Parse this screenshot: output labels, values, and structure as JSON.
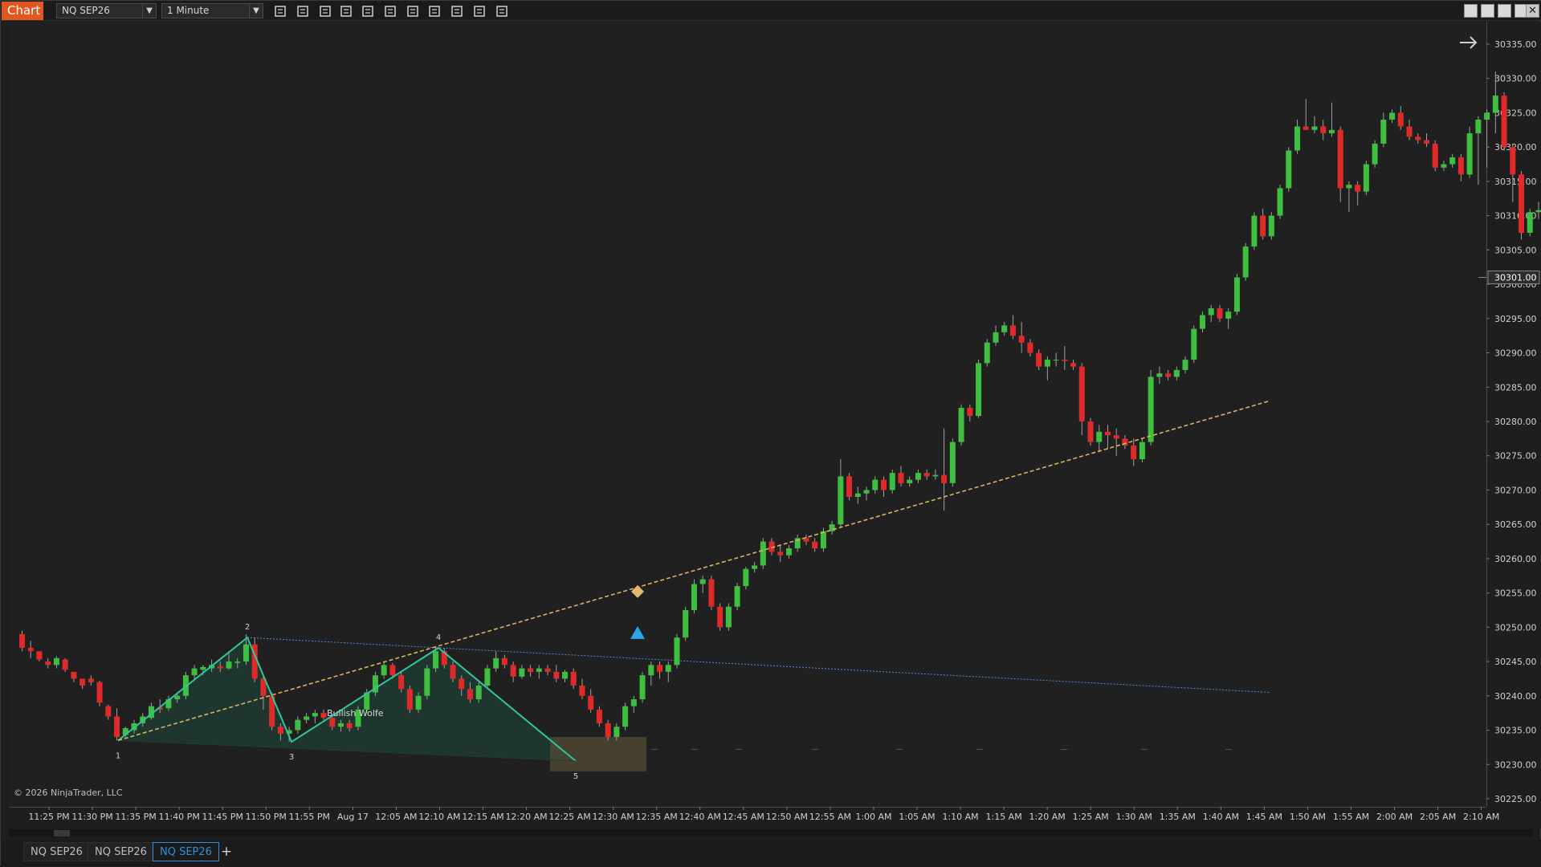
{
  "toolbar": {
    "chart_label": "Chart",
    "instrument": "NQ SEP26",
    "interval": "1 Minute",
    "tools": [
      "bar-type-icon",
      "pencil-icon",
      "zoom-in-icon",
      "zoom-out-icon",
      "pointer-icon",
      "properties-icon",
      "data-box-icon",
      "strategies-icon",
      "indicators-icon",
      "chart-trader-icon",
      "list-icon"
    ],
    "window_buttons": [
      "tile-icon",
      "maximize-icon",
      "minimize-icon",
      "restore-icon",
      "close-icon"
    ]
  },
  "tabs": [
    {
      "label": "NQ SEP26",
      "active": false
    },
    {
      "label": "NQ SEP26",
      "active": false
    },
    {
      "label": "NQ SEP26",
      "active": true
    }
  ],
  "add_tab_label": "+",
  "copyright": "© 2026 NinjaTrader, LLC",
  "colors": {
    "up": "#3fbf3f",
    "down": "#e02a2a",
    "wolfe_line": "#2fc7a0",
    "wolfe_fill": "#1f3b31",
    "target_line": "#d9b45a",
    "blue_line": "#4a8fd0",
    "target_box": "#4e4632",
    "price_marker": "#2c2c2c"
  },
  "chart_data": {
    "type": "candlestick",
    "price_axis": {
      "ticks": [
        "30335.00",
        "30330.00",
        "30325.00",
        "30320.00",
        "30315.00",
        "30310.00",
        "30305.00",
        "30300.00",
        "30295.00",
        "30290.00",
        "30285.00",
        "30280.00",
        "30275.00",
        "30270.00",
        "30265.00",
        "30260.00",
        "30255.00",
        "30250.00",
        "30245.00",
        "30240.00",
        "30235.00",
        "30230.00",
        "30225.00"
      ],
      "range": [
        30224,
        30336
      ],
      "current_price": "30301.00"
    },
    "time_axis": {
      "labels": [
        "11:25 PM",
        "11:30 PM",
        "11:35 PM",
        "11:40 PM",
        "11:45 PM",
        "11:50 PM",
        "11:55 PM",
        "Aug 17",
        "12:05 AM",
        "12:10 AM",
        "12:15 AM",
        "12:20 AM",
        "12:25 AM",
        "12:30 AM",
        "12:35 AM",
        "12:40 AM",
        "12:45 AM",
        "12:50 AM",
        "12:55 AM",
        "1:00 AM",
        "1:05 AM",
        "1:10 AM",
        "1:15 AM",
        "1:20 AM",
        "1:25 AM",
        "1:30 AM",
        "1:35 AM",
        "1:40 AM",
        "1:45 AM",
        "1:50 AM",
        "1:55 AM",
        "2:00 AM",
        "2:05 AM",
        "2:10 AM"
      ]
    },
    "candles": [
      [
        30249,
        30249.5,
        30246.5,
        30247
      ],
      [
        30247,
        30248,
        30245.5,
        30246.5
      ],
      [
        30246.5,
        30246.5,
        30245,
        30245.3
      ],
      [
        30245,
        30245.5,
        30244,
        30244.5
      ],
      [
        30244.5,
        30245.8,
        30244,
        30245.5
      ],
      [
        30245.3,
        30245.5,
        30243.5,
        30243.8
      ],
      [
        30243.5,
        30243.5,
        30242,
        30242.5
      ],
      [
        30242.5,
        30242.5,
        30241,
        30241.5
      ],
      [
        30242.5,
        30243,
        30241.5,
        30242
      ],
      [
        30242,
        30242.2,
        30238.5,
        30239
      ],
      [
        30238.5,
        30238.7,
        30236.5,
        30237
      ],
      [
        30237,
        30238.2,
        30233.5,
        30234
      ],
      [
        30234.3,
        30235.5,
        30234,
        30235.3
      ],
      [
        30235,
        30236.5,
        30234.5,
        30236
      ],
      [
        30236,
        30237.5,
        30235.5,
        30237
      ],
      [
        30236.8,
        30239,
        30236.5,
        30238.5
      ],
      [
        30238.3,
        30239.5,
        30237.5,
        30238
      ],
      [
        30238.2,
        30240,
        30237.8,
        30239.5
      ],
      [
        30239.5,
        30240.5,
        30239,
        30240
      ],
      [
        30240,
        30243.5,
        30239.5,
        30243
      ],
      [
        30243,
        30244.5,
        30242.5,
        30244
      ],
      [
        30243.8,
        30244.5,
        30243,
        30244.2
      ],
      [
        30244,
        30245.3,
        30243.5,
        30244.5
      ],
      [
        30244.3,
        30245,
        30243.5,
        30244
      ],
      [
        30244,
        30246.5,
        30243.8,
        30245
      ],
      [
        30244.8,
        30245.5,
        30244,
        30245
      ],
      [
        30245,
        30249,
        30244.5,
        30247.5
      ],
      [
        30247.5,
        30248.5,
        30242,
        30242.5
      ],
      [
        30242.5,
        30243,
        30238,
        30240
      ],
      [
        30240,
        30240.5,
        30235,
        30235.5
      ],
      [
        30235.5,
        30236,
        30233.5,
        30234.5
      ],
      [
        30234.5,
        30235.5,
        30233.3,
        30235
      ],
      [
        30235,
        30237,
        30234.5,
        30236.5
      ],
      [
        30236.5,
        30237.5,
        30236,
        30237
      ],
      [
        30237,
        30238,
        30236,
        30237.5
      ],
      [
        30237.5,
        30238,
        30236.5,
        30236.8
      ],
      [
        30236.8,
        30237.2,
        30235,
        30235.5
      ],
      [
        30235.5,
        30236.5,
        30234.8,
        30236
      ],
      [
        30236,
        30236.5,
        30234.8,
        30235.3
      ],
      [
        30235.5,
        30238.5,
        30235,
        30238
      ],
      [
        30238,
        30241,
        30237.5,
        30240.5
      ],
      [
        30240.5,
        30243.5,
        30240,
        30243
      ],
      [
        30243,
        30245,
        30242.5,
        30244.5
      ],
      [
        30244.5,
        30244.8,
        30242.5,
        30243
      ],
      [
        30243,
        30243.5,
        30240.5,
        30241
      ],
      [
        30241,
        30241.5,
        30237.5,
        30238
      ],
      [
        30238,
        30240.5,
        30237.5,
        30240
      ],
      [
        30240,
        30244.5,
        30239.5,
        30244
      ],
      [
        30244,
        30247.2,
        30243.5,
        30246.5
      ],
      [
        30246.5,
        30247,
        30244,
        30244.5
      ],
      [
        30244.5,
        30245,
        30242,
        30242.5
      ],
      [
        30242.5,
        30243,
        30240,
        30241
      ],
      [
        30241,
        30242,
        30239,
        30239.5
      ],
      [
        30239.5,
        30242,
        30239,
        30241.5
      ],
      [
        30241.5,
        30244.5,
        30241,
        30244
      ],
      [
        30244,
        30246.5,
        30243.5,
        30245.5
      ],
      [
        30245.5,
        30246,
        30244,
        30244.5
      ],
      [
        30244.5,
        30245,
        30242,
        30242.8
      ],
      [
        30242.8,
        30244.5,
        30242.5,
        30244
      ],
      [
        30244,
        30244.5,
        30242.8,
        30243.5
      ],
      [
        30243.5,
        30244.5,
        30242.5,
        30244
      ],
      [
        30244,
        30244.5,
        30243,
        30243.5
      ],
      [
        30243.5,
        30244.5,
        30242,
        30242.5
      ],
      [
        30242.5,
        30243.8,
        30242,
        30243.5
      ],
      [
        30243.5,
        30244,
        30241,
        30241.5
      ],
      [
        30241.5,
        30242.5,
        30239.5,
        30240
      ],
      [
        30240,
        30241,
        30237.5,
        30238
      ],
      [
        30238,
        30238.5,
        30235.5,
        30236
      ],
      [
        30236,
        30236.5,
        30233.5,
        30234
      ],
      [
        30234,
        30236,
        30233.5,
        30235.5
      ],
      [
        30235.5,
        30239,
        30235,
        30238.5
      ],
      [
        30238.5,
        30240,
        30237.5,
        30239.5
      ],
      [
        30239.5,
        30243.5,
        30239,
        30243
      ],
      [
        30243,
        30245,
        30241.5,
        30244.5
      ],
      [
        30244.5,
        30245,
        30242.5,
        30243.5
      ],
      [
        30243.5,
        30245,
        30242,
        30244.5
      ],
      [
        30244.5,
        30249,
        30244,
        30248.5
      ],
      [
        30248.5,
        30253,
        30248,
        30252.5
      ],
      [
        30252.5,
        30257,
        30252,
        30256.3
      ],
      [
        30256.3,
        30257.5,
        30255,
        30257
      ],
      [
        30257,
        30257.5,
        30252.5,
        30253
      ],
      [
        30253,
        30253.5,
        30249.5,
        30250
      ],
      [
        30250,
        30253.5,
        30249.5,
        30253
      ],
      [
        30253,
        30256.5,
        30252.5,
        30256
      ],
      [
        30256,
        30258.8,
        30255.5,
        30258.5
      ],
      [
        30258.5,
        30259.5,
        30258,
        30259
      ],
      [
        30259,
        30263,
        30258.5,
        30262.5
      ],
      [
        30262.5,
        30263,
        30260.5,
        30261
      ],
      [
        30261,
        30262,
        30259.5,
        30260.5
      ],
      [
        30260.5,
        30262,
        30260,
        30261.5
      ],
      [
        30261.5,
        30263.5,
        30261,
        30263
      ],
      [
        30263,
        30263.5,
        30262,
        30262.5
      ],
      [
        30262.5,
        30263,
        30261,
        30261.5
      ],
      [
        30261.5,
        30264.5,
        30261,
        30264
      ],
      [
        30264,
        30265.5,
        30263.5,
        30265
      ],
      [
        30265,
        30274.5,
        30264.5,
        30272
      ],
      [
        30272,
        30272.5,
        30268.5,
        30269
      ],
      [
        30269,
        30270.5,
        30268,
        30269.5
      ],
      [
        30269.5,
        30270.5,
        30268.5,
        30270
      ],
      [
        30270,
        30272,
        30269.5,
        30271.5
      ],
      [
        30271.5,
        30272,
        30269,
        30270
      ],
      [
        30270,
        30273,
        30269.5,
        30272.5
      ],
      [
        30272.5,
        30273.5,
        30270.5,
        30271
      ],
      [
        30271,
        30272,
        30270.5,
        30271.5
      ],
      [
        30271.5,
        30273,
        30271,
        30272.5
      ],
      [
        30272.5,
        30273,
        30271.5,
        30272
      ],
      [
        30272,
        30273,
        30271.5,
        30272.2
      ],
      [
        30272.2,
        30279,
        30267,
        30271
      ],
      [
        30271,
        30277.5,
        30270.5,
        30277
      ],
      [
        30277,
        30282.5,
        30276.5,
        30282
      ],
      [
        30282,
        30282.5,
        30280,
        30280.8
      ],
      [
        30280.8,
        30289,
        30280.5,
        30288.5
      ],
      [
        30288.5,
        30292,
        30288,
        30291.5
      ],
      [
        30291.5,
        30294,
        30291,
        30293
      ],
      [
        30293,
        30294.5,
        30292.5,
        30294
      ],
      [
        30294,
        30295.5,
        30292,
        30292.5
      ],
      [
        30292.5,
        30294.5,
        30290,
        30291.5
      ],
      [
        30291.5,
        30292,
        30289.5,
        30290
      ],
      [
        30290,
        30290.5,
        30287.5,
        30288
      ],
      [
        30288,
        30289.5,
        30286,
        30289
      ],
      [
        30289,
        30290,
        30288,
        30289
      ],
      [
        30289,
        30291,
        30287.5,
        30288.8
      ],
      [
        30288.5,
        30289,
        30287.5,
        30288
      ],
      [
        30288,
        30288.5,
        30278,
        30280
      ],
      [
        30280,
        30280.5,
        30276.5,
        30277
      ],
      [
        30277,
        30279.5,
        30275.5,
        30278.5
      ],
      [
        30278.5,
        30279.5,
        30276,
        30278
      ],
      [
        30278,
        30279,
        30275,
        30277.5
      ],
      [
        30277.5,
        30278,
        30276,
        30276.5
      ],
      [
        30276.5,
        30277.5,
        30273.5,
        30274.5
      ],
      [
        30274.5,
        30277.5,
        30274,
        30277
      ],
      [
        30277,
        30287.5,
        30276.5,
        30286.5
      ],
      [
        30286.5,
        30288,
        30285.5,
        30287
      ],
      [
        30287,
        30287.5,
        30286,
        30286.5
      ],
      [
        30286.5,
        30288,
        30286,
        30287.5
      ],
      [
        30287.5,
        30289.5,
        30287,
        30289
      ],
      [
        30289,
        30294,
        30288.5,
        30293.5
      ],
      [
        30293.5,
        30296,
        30293,
        30295.5
      ],
      [
        30295.5,
        30297,
        30294.5,
        30296.5
      ],
      [
        30296.5,
        30297,
        30294.5,
        30295
      ],
      [
        30295,
        30296.5,
        30293.5,
        30296
      ],
      [
        30296,
        30301.5,
        30295.5,
        30301
      ],
      [
        30301,
        30306,
        30300.5,
        30305.5
      ],
      [
        30305.5,
        30310.5,
        30305,
        30310
      ],
      [
        30310,
        30311,
        30306.5,
        30307
      ],
      [
        30307,
        30310.5,
        30306.5,
        30310
      ],
      [
        30310,
        30314.5,
        30309.5,
        30314
      ],
      [
        30314,
        30320,
        30313.5,
        30319.5
      ],
      [
        30319.5,
        30324,
        30319,
        30323
      ],
      [
        30323,
        30327,
        30322.5,
        30322.5
      ],
      [
        30322.5,
        30324.5,
        30322,
        30323
      ],
      [
        30323,
        30324,
        30321,
        30322
      ],
      [
        30322,
        30326.5,
        30321.5,
        30322.5
      ],
      [
        30322.5,
        30323,
        30312,
        30314
      ],
      [
        30314,
        30315,
        30310.5,
        30314.5
      ],
      [
        30314.5,
        30315,
        30311.5,
        30313.5
      ],
      [
        30313.5,
        30318,
        30313,
        30317.5
      ],
      [
        30317.5,
        30321,
        30317,
        30320.5
      ],
      [
        30320.5,
        30325,
        30320,
        30324
      ],
      [
        30324,
        30325.5,
        30323.5,
        30325
      ],
      [
        30325,
        30326,
        30322.5,
        30323
      ],
      [
        30323,
        30324,
        30321,
        30321.5
      ],
      [
        30321.5,
        30322,
        30320.5,
        30321
      ],
      [
        30321,
        30322,
        30320,
        30320.5
      ],
      [
        30320.5,
        30321,
        30316.5,
        30317
      ],
      [
        30317,
        30318,
        30316.5,
        30317.5
      ],
      [
        30317.5,
        30319,
        30317,
        30318.5
      ],
      [
        30318.5,
        30319,
        30315,
        30316
      ],
      [
        30316,
        30323,
        30315.5,
        30322
      ],
      [
        30322,
        30324.5,
        30314.5,
        30324
      ],
      [
        30324,
        30325.5,
        30317,
        30325
      ],
      [
        30325,
        30331,
        30322,
        30327.5
      ],
      [
        30327.5,
        30328,
        30319.5,
        30320
      ],
      [
        30320,
        30320.5,
        30312,
        30316
      ],
      [
        30316,
        30316.5,
        30306.5,
        30307.5
      ],
      [
        30307.5,
        30311,
        30307,
        30310.5
      ],
      [
        30310.5,
        30312,
        30309.5,
        30310.8
      ],
      [
        30310.8,
        30311,
        30300.5,
        30301
      ],
      [
        30301,
        30301.5,
        30298.5,
        30299
      ],
      [
        30299,
        30302,
        30298.5,
        30301
      ],
      [
        30301,
        30301.5,
        30300.5,
        30301
      ]
    ],
    "wolfe_points": [
      {
        "label": "1",
        "value": 30233.5
      },
      {
        "label": "2",
        "value": 30248.5
      },
      {
        "label": "3",
        "value": 30233.3
      },
      {
        "label": "4",
        "value": 30247
      },
      {
        "label": "5",
        "value": 30230.5
      }
    ],
    "pattern_label": "Bullish Wolfe",
    "target_box": {
      "low": 30229,
      "high": 30234
    },
    "signal_value": 30255.2,
    "target_line_end_value": 30283,
    "blue_line": {
      "start_value": 30248.5,
      "end_value": 30240.5
    }
  }
}
